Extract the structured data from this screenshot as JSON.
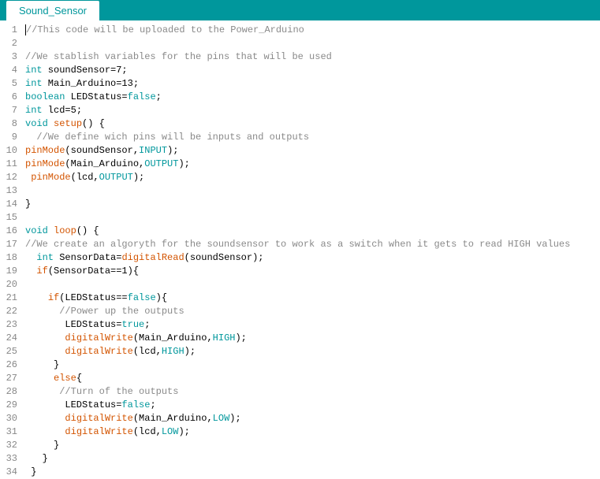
{
  "tab": {
    "title": "Sound_Sensor"
  },
  "code": {
    "lines": [
      {
        "n": 1,
        "tokens": [
          {
            "c": "cursor",
            "t": ""
          },
          {
            "c": "comment",
            "t": "//This code will be uploaded to the Power_Arduino"
          }
        ]
      },
      {
        "n": 2,
        "tokens": []
      },
      {
        "n": 3,
        "tokens": [
          {
            "c": "comment",
            "t": "//We stablish variables for the pins that will be used"
          }
        ]
      },
      {
        "n": 4,
        "tokens": [
          {
            "c": "kw",
            "t": "int"
          },
          {
            "c": "",
            "t": " soundSensor=7;"
          }
        ]
      },
      {
        "n": 5,
        "tokens": [
          {
            "c": "kw",
            "t": "int"
          },
          {
            "c": "",
            "t": " Main_Arduino=13;"
          }
        ]
      },
      {
        "n": 6,
        "tokens": [
          {
            "c": "kw",
            "t": "boolean"
          },
          {
            "c": "",
            "t": " LEDStatus="
          },
          {
            "c": "kw",
            "t": "false"
          },
          {
            "c": "",
            "t": ";"
          }
        ]
      },
      {
        "n": 7,
        "tokens": [
          {
            "c": "kw",
            "t": "int"
          },
          {
            "c": "",
            "t": " lcd=5;"
          }
        ]
      },
      {
        "n": 8,
        "tokens": [
          {
            "c": "kw",
            "t": "void"
          },
          {
            "c": "",
            "t": " "
          },
          {
            "c": "func",
            "t": "setup"
          },
          {
            "c": "",
            "t": "() {"
          }
        ]
      },
      {
        "n": 9,
        "tokens": [
          {
            "c": "",
            "t": "  "
          },
          {
            "c": "comment",
            "t": "//We define wich pins will be inputs and outputs"
          }
        ]
      },
      {
        "n": 10,
        "tokens": [
          {
            "c": "func",
            "t": "pinMode"
          },
          {
            "c": "",
            "t": "(soundSensor,"
          },
          {
            "c": "const",
            "t": "INPUT"
          },
          {
            "c": "",
            "t": ");"
          }
        ]
      },
      {
        "n": 11,
        "tokens": [
          {
            "c": "func",
            "t": "pinMode"
          },
          {
            "c": "",
            "t": "(Main_Arduino,"
          },
          {
            "c": "const",
            "t": "OUTPUT"
          },
          {
            "c": "",
            "t": ");"
          }
        ]
      },
      {
        "n": 12,
        "tokens": [
          {
            "c": "",
            "t": " "
          },
          {
            "c": "func",
            "t": "pinMode"
          },
          {
            "c": "",
            "t": "(lcd,"
          },
          {
            "c": "const",
            "t": "OUTPUT"
          },
          {
            "c": "",
            "t": ");"
          }
        ]
      },
      {
        "n": 13,
        "tokens": []
      },
      {
        "n": 14,
        "tokens": [
          {
            "c": "",
            "t": "}"
          }
        ]
      },
      {
        "n": 15,
        "tokens": []
      },
      {
        "n": 16,
        "tokens": [
          {
            "c": "kw",
            "t": "void"
          },
          {
            "c": "",
            "t": " "
          },
          {
            "c": "func",
            "t": "loop"
          },
          {
            "c": "",
            "t": "() {"
          }
        ]
      },
      {
        "n": 17,
        "tokens": [
          {
            "c": "comment",
            "t": "//We create an algoryth for the soundsensor to work as a switch when it gets to read HIGH values"
          }
        ]
      },
      {
        "n": 18,
        "tokens": [
          {
            "c": "",
            "t": "  "
          },
          {
            "c": "kw",
            "t": "int"
          },
          {
            "c": "",
            "t": " SensorData="
          },
          {
            "c": "func",
            "t": "digitalRead"
          },
          {
            "c": "",
            "t": "(soundSensor);"
          }
        ]
      },
      {
        "n": 19,
        "tokens": [
          {
            "c": "",
            "t": "  "
          },
          {
            "c": "func",
            "t": "if"
          },
          {
            "c": "",
            "t": "(SensorData==1){"
          }
        ]
      },
      {
        "n": 20,
        "tokens": []
      },
      {
        "n": 21,
        "tokens": [
          {
            "c": "",
            "t": "    "
          },
          {
            "c": "func",
            "t": "if"
          },
          {
            "c": "",
            "t": "(LEDStatus=="
          },
          {
            "c": "kw",
            "t": "false"
          },
          {
            "c": "",
            "t": "){"
          }
        ]
      },
      {
        "n": 22,
        "tokens": [
          {
            "c": "",
            "t": "      "
          },
          {
            "c": "comment",
            "t": "//Power up the outputs"
          }
        ]
      },
      {
        "n": 23,
        "tokens": [
          {
            "c": "",
            "t": "       LEDStatus="
          },
          {
            "c": "kw",
            "t": "true"
          },
          {
            "c": "",
            "t": ";"
          }
        ]
      },
      {
        "n": 24,
        "tokens": [
          {
            "c": "",
            "t": "       "
          },
          {
            "c": "func",
            "t": "digitalWrite"
          },
          {
            "c": "",
            "t": "(Main_Arduino,"
          },
          {
            "c": "const",
            "t": "HIGH"
          },
          {
            "c": "",
            "t": ");"
          }
        ]
      },
      {
        "n": 25,
        "tokens": [
          {
            "c": "",
            "t": "       "
          },
          {
            "c": "func",
            "t": "digitalWrite"
          },
          {
            "c": "",
            "t": "(lcd,"
          },
          {
            "c": "const",
            "t": "HIGH"
          },
          {
            "c": "",
            "t": ");"
          }
        ]
      },
      {
        "n": 26,
        "tokens": [
          {
            "c": "",
            "t": "     }"
          }
        ]
      },
      {
        "n": 27,
        "tokens": [
          {
            "c": "",
            "t": "     "
          },
          {
            "c": "func",
            "t": "else"
          },
          {
            "c": "",
            "t": "{"
          }
        ]
      },
      {
        "n": 28,
        "tokens": [
          {
            "c": "",
            "t": "      "
          },
          {
            "c": "comment",
            "t": "//Turn of the outputs"
          }
        ]
      },
      {
        "n": 29,
        "tokens": [
          {
            "c": "",
            "t": "       LEDStatus="
          },
          {
            "c": "kw",
            "t": "false"
          },
          {
            "c": "",
            "t": ";"
          }
        ]
      },
      {
        "n": 30,
        "tokens": [
          {
            "c": "",
            "t": "       "
          },
          {
            "c": "func",
            "t": "digitalWrite"
          },
          {
            "c": "",
            "t": "(Main_Arduino,"
          },
          {
            "c": "const",
            "t": "LOW"
          },
          {
            "c": "",
            "t": ");"
          }
        ]
      },
      {
        "n": 31,
        "tokens": [
          {
            "c": "",
            "t": "       "
          },
          {
            "c": "func",
            "t": "digitalWrite"
          },
          {
            "c": "",
            "t": "(lcd,"
          },
          {
            "c": "const",
            "t": "LOW"
          },
          {
            "c": "",
            "t": ");"
          }
        ]
      },
      {
        "n": 32,
        "tokens": [
          {
            "c": "",
            "t": "     }"
          }
        ]
      },
      {
        "n": 33,
        "tokens": [
          {
            "c": "",
            "t": "   }"
          }
        ]
      },
      {
        "n": 34,
        "tokens": [
          {
            "c": "",
            "t": " }"
          }
        ]
      }
    ]
  }
}
